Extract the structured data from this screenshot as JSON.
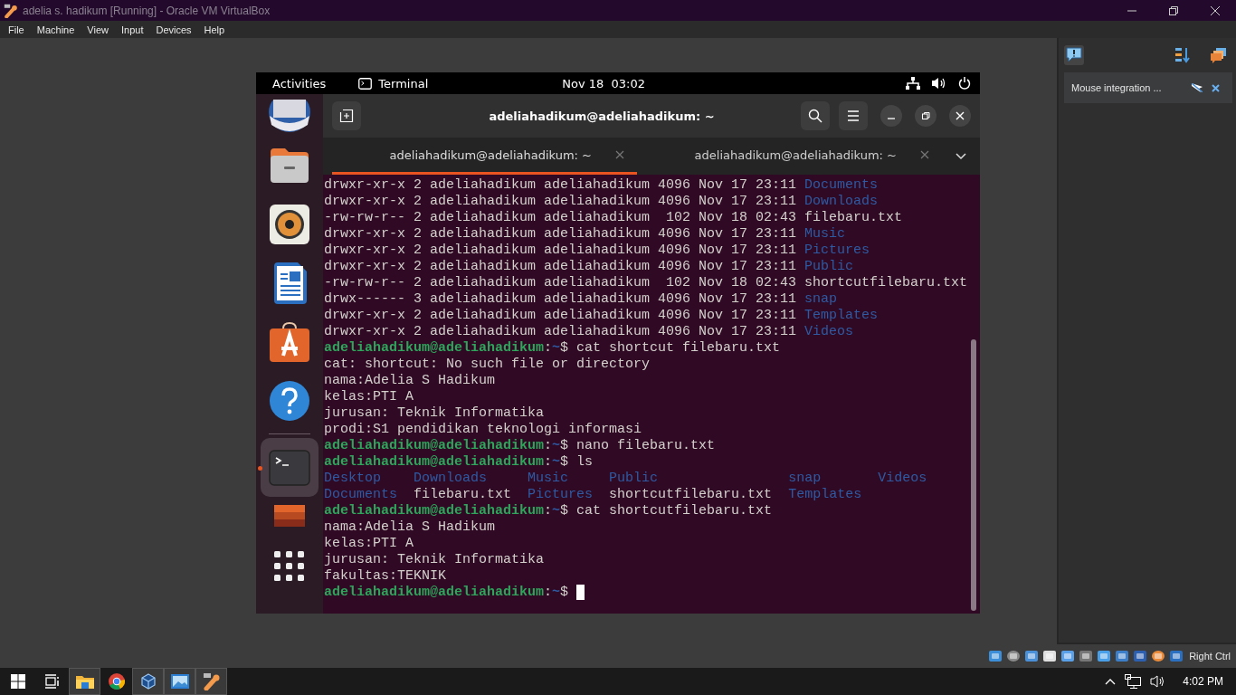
{
  "window": {
    "title": "adelia s. hadikum [Running] - Oracle VM VirtualBox"
  },
  "menu": [
    "File",
    "Machine",
    "View",
    "Input",
    "Devices",
    "Help"
  ],
  "notifications": {
    "items": [
      {
        "text": "Mouse integration ..."
      }
    ]
  },
  "guest": {
    "top_bar": {
      "activities": "Activities",
      "app": "Terminal",
      "clock": "Nov 18  03:02"
    },
    "dock": [
      {
        "kind": "mail",
        "selected": false
      },
      {
        "kind": "files",
        "selected": false
      },
      {
        "kind": "music",
        "selected": false
      },
      {
        "kind": "writer",
        "selected": false
      },
      {
        "kind": "store",
        "selected": false
      },
      {
        "kind": "help",
        "selected": false
      },
      {
        "kind": "terminal",
        "selected": true
      },
      {
        "kind": "disk",
        "selected": false
      },
      {
        "kind": "apps",
        "selected": false
      }
    ],
    "terminal": {
      "title": "adeliahadikum@adeliahadikum: ~",
      "tabs": [
        {
          "label": "adeliahadikum@adeliahadikum: ~",
          "selected": true
        },
        {
          "label": "adeliahadikum@adeliahadikum: ~",
          "selected": false
        }
      ],
      "lines": [
        [
          {
            "text": "drwxr-xr-x 2 adeliahadikum adeliahadikum 4096 Nov 17 23:11 ",
            "kind": "plain"
          },
          {
            "text": "Documents",
            "kind": "dir"
          }
        ],
        [
          {
            "text": "drwxr-xr-x 2 adeliahadikum adeliahadikum 4096 Nov 17 23:11 ",
            "kind": "plain"
          },
          {
            "text": "Downloads",
            "kind": "dir"
          }
        ],
        [
          {
            "text": "-rw-rw-r-- 2 adeliahadikum adeliahadikum  102 Nov 18 02:43 filebaru.txt",
            "kind": "plain"
          }
        ],
        [
          {
            "text": "drwxr-xr-x 2 adeliahadikum adeliahadikum 4096 Nov 17 23:11 ",
            "kind": "plain"
          },
          {
            "text": "Music",
            "kind": "dir"
          }
        ],
        [
          {
            "text": "drwxr-xr-x 2 adeliahadikum adeliahadikum 4096 Nov 17 23:11 ",
            "kind": "plain"
          },
          {
            "text": "Pictures",
            "kind": "dir"
          }
        ],
        [
          {
            "text": "drwxr-xr-x 2 adeliahadikum adeliahadikum 4096 Nov 17 23:11 ",
            "kind": "plain"
          },
          {
            "text": "Public",
            "kind": "dir"
          }
        ],
        [
          {
            "text": "-rw-rw-r-- 2 adeliahadikum adeliahadikum  102 Nov 18 02:43 shortcutfilebaru.txt",
            "kind": "plain"
          }
        ],
        [
          {
            "text": "drwx------ 3 adeliahadikum adeliahadikum 4096 Nov 17 23:11 ",
            "kind": "plain"
          },
          {
            "text": "snap",
            "kind": "dir"
          }
        ],
        [
          {
            "text": "drwxr-xr-x 2 adeliahadikum adeliahadikum 4096 Nov 17 23:11 ",
            "kind": "plain"
          },
          {
            "text": "Templates",
            "kind": "dir"
          }
        ],
        [
          {
            "text": "drwxr-xr-x 2 adeliahadikum adeliahadikum 4096 Nov 17 23:11 ",
            "kind": "plain"
          },
          {
            "text": "Videos",
            "kind": "dir"
          }
        ],
        [
          {
            "text": "adeliahadikum@adeliahadikum",
            "kind": "user"
          },
          {
            "text": ":",
            "kind": "plain"
          },
          {
            "text": "~",
            "kind": "path"
          },
          {
            "text": "$ cat shortcut filebaru.txt",
            "kind": "plain"
          }
        ],
        [
          {
            "text": "cat: shortcut: No such file or directory",
            "kind": "plain"
          }
        ],
        [
          {
            "text": "nama:Adelia S Hadikum",
            "kind": "plain"
          }
        ],
        [
          {
            "text": "kelas:PTI A",
            "kind": "plain"
          }
        ],
        [
          {
            "text": "jurusan: Teknik Informatika",
            "kind": "plain"
          }
        ],
        [
          {
            "text": "prodi:S1 pendidikan teknologi informasi",
            "kind": "plain"
          }
        ],
        [
          {
            "text": "adeliahadikum@adeliahadikum",
            "kind": "user"
          },
          {
            "text": ":",
            "kind": "plain"
          },
          {
            "text": "~",
            "kind": "path"
          },
          {
            "text": "$ nano filebaru.txt",
            "kind": "plain"
          }
        ],
        [
          {
            "text": "adeliahadikum@adeliahadikum",
            "kind": "user"
          },
          {
            "text": ":",
            "kind": "plain"
          },
          {
            "text": "~",
            "kind": "path"
          },
          {
            "text": "$ ls",
            "kind": "plain"
          }
        ],
        [
          {
            "text": "Desktop    ",
            "kind": "dir"
          },
          {
            "text": "Downloads     ",
            "kind": "dir"
          },
          {
            "text": "Music     ",
            "kind": "dir"
          },
          {
            "text": "Public                ",
            "kind": "dir"
          },
          {
            "text": "snap       ",
            "kind": "dir"
          },
          {
            "text": "Videos",
            "kind": "dir"
          }
        ],
        [
          {
            "text": "Documents  ",
            "kind": "dir"
          },
          {
            "text": "filebaru.txt  ",
            "kind": "plain"
          },
          {
            "text": "Pictures  ",
            "kind": "dir"
          },
          {
            "text": "shortcutfilebaru.txt  ",
            "kind": "plain"
          },
          {
            "text": "Templates",
            "kind": "dir"
          }
        ],
        [
          {
            "text": "adeliahadikum@adeliahadikum",
            "kind": "user"
          },
          {
            "text": ":",
            "kind": "plain"
          },
          {
            "text": "~",
            "kind": "path"
          },
          {
            "text": "$ cat shortcutfilebaru.txt",
            "kind": "plain"
          }
        ],
        [
          {
            "text": "nama:Adelia S Hadikum",
            "kind": "plain"
          }
        ],
        [
          {
            "text": "kelas:PTI A",
            "kind": "plain"
          }
        ],
        [
          {
            "text": "jurusan: Teknik Informatika",
            "kind": "plain"
          }
        ],
        [
          {
            "text": "fakultas:TEKNIK",
            "kind": "plain"
          }
        ],
        [
          {
            "text": "adeliahadikum@adeliahadikum",
            "kind": "user"
          },
          {
            "text": ":",
            "kind": "plain"
          },
          {
            "text": "~",
            "kind": "path"
          },
          {
            "text": "$ ",
            "kind": "plain"
          }
        ]
      ],
      "cursor": true
    }
  },
  "status_bar": {
    "host_key": "Right Ctrl"
  },
  "taskbar": {
    "apps": [
      {
        "kind": "explorer",
        "running": true
      },
      {
        "kind": "browser",
        "running": false
      },
      {
        "kind": "cube",
        "running": true
      },
      {
        "kind": "photos",
        "running": true
      },
      {
        "kind": "vm",
        "running": true
      }
    ],
    "clock": "4:02 PM"
  }
}
